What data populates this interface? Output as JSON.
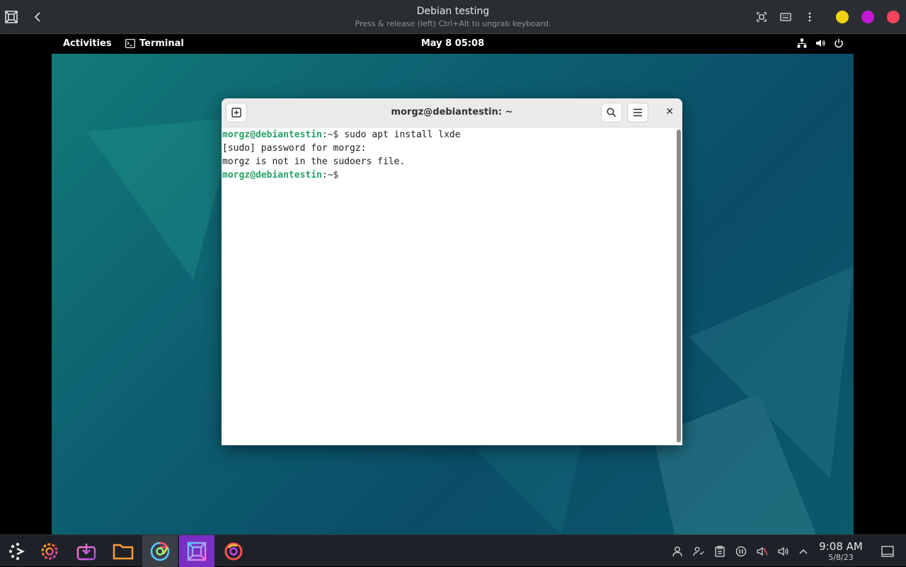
{
  "host": {
    "title": "Debian testing",
    "subtitle": "Press & release (left) Ctrl+Alt to ungrab keyboard.",
    "dot_colors": [
      "#f2d20f",
      "#c418d6",
      "#f2445a"
    ]
  },
  "gnome": {
    "activities": "Activities",
    "app_name": "Terminal",
    "clock": "May 8  05:08"
  },
  "terminal": {
    "title": "morgz@debiantestin: ~",
    "lines": [
      {
        "user": "morgz@debiantestin",
        "path": ":~$",
        "cmd": " sudo apt install lxde"
      },
      {
        "text": "[sudo] password for morgz:"
      },
      {
        "text": "morgz is not in the sudoers file."
      },
      {
        "user": "morgz@debiantestin",
        "path": ":~$",
        "cmd": ""
      }
    ]
  },
  "taskbar": {
    "time": "9:08 AM",
    "date": "5/8/23"
  }
}
